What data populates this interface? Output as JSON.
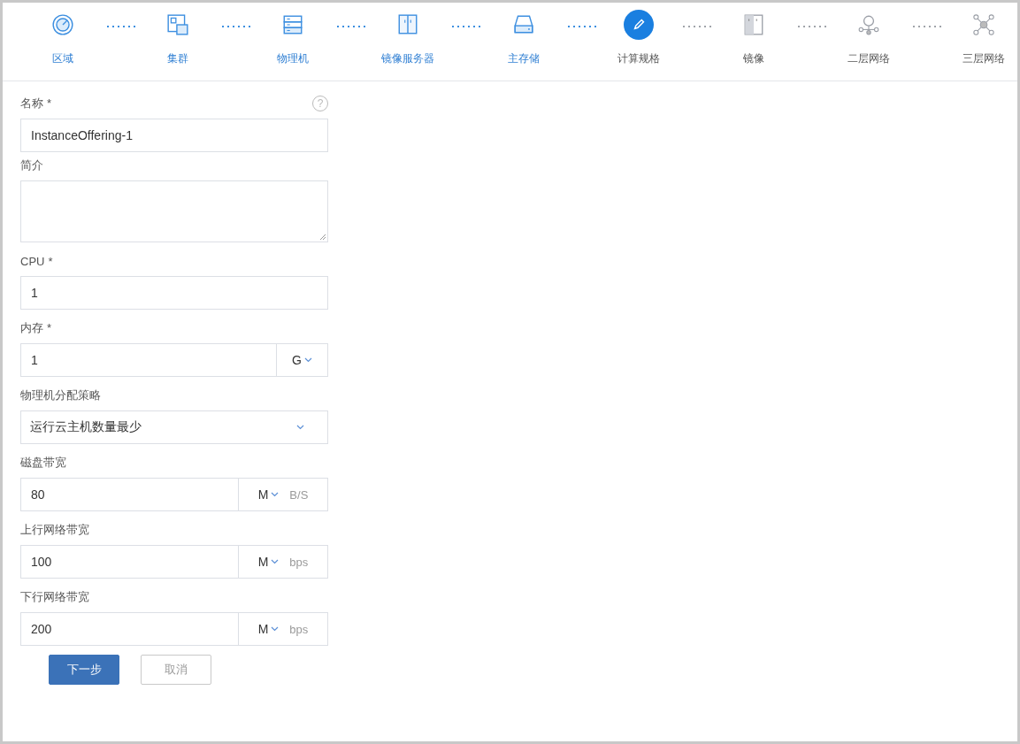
{
  "steps": [
    {
      "label": "区域",
      "kind": "zone",
      "done": true,
      "selected": false
    },
    {
      "label": "集群",
      "kind": "cluster",
      "done": true,
      "selected": false
    },
    {
      "label": "物理机",
      "kind": "host",
      "done": true,
      "selected": false
    },
    {
      "label": "镜像服务器",
      "kind": "backup-storage",
      "done": true,
      "selected": false
    },
    {
      "label": "主存储",
      "kind": "primary-storage",
      "done": true,
      "selected": false
    },
    {
      "label": "计算规格",
      "kind": "offering",
      "done": false,
      "selected": true
    },
    {
      "label": "镜像",
      "kind": "image",
      "done": false,
      "selected": false
    },
    {
      "label": "二层网络",
      "kind": "l2",
      "done": false,
      "selected": false
    },
    {
      "label": "三层网络",
      "kind": "l3",
      "done": false,
      "selected": false
    }
  ],
  "form": {
    "fields": [
      {
        "kind": "text",
        "label": "名称",
        "required_mark": "*",
        "help": "?",
        "value": "InstanceOffering-1"
      },
      {
        "kind": "textarea",
        "label": "简介"
      },
      {
        "kind": "text",
        "label": "CPU",
        "required_mark": "*",
        "value": "1"
      },
      {
        "kind": "unit",
        "label": "内存",
        "required_mark": "*",
        "value": "1",
        "unit": "G"
      },
      {
        "kind": "select",
        "label": "物理机分配策略",
        "value": "运行云主机数量最少"
      },
      {
        "kind": "unit",
        "label": "磁盘带宽",
        "value": "80",
        "unit": "M",
        "suffix": "B/S"
      },
      {
        "kind": "unit",
        "label": "上行网络带宽",
        "value": "100",
        "unit": "M",
        "suffix": "bps"
      },
      {
        "kind": "unit",
        "label": "下行网络带宽",
        "value": "200",
        "unit": "M",
        "suffix": "bps"
      }
    ],
    "buttons": [
      {
        "label": "下一步",
        "kind": "primary"
      },
      {
        "label": "取消",
        "kind": "secondary"
      }
    ]
  }
}
